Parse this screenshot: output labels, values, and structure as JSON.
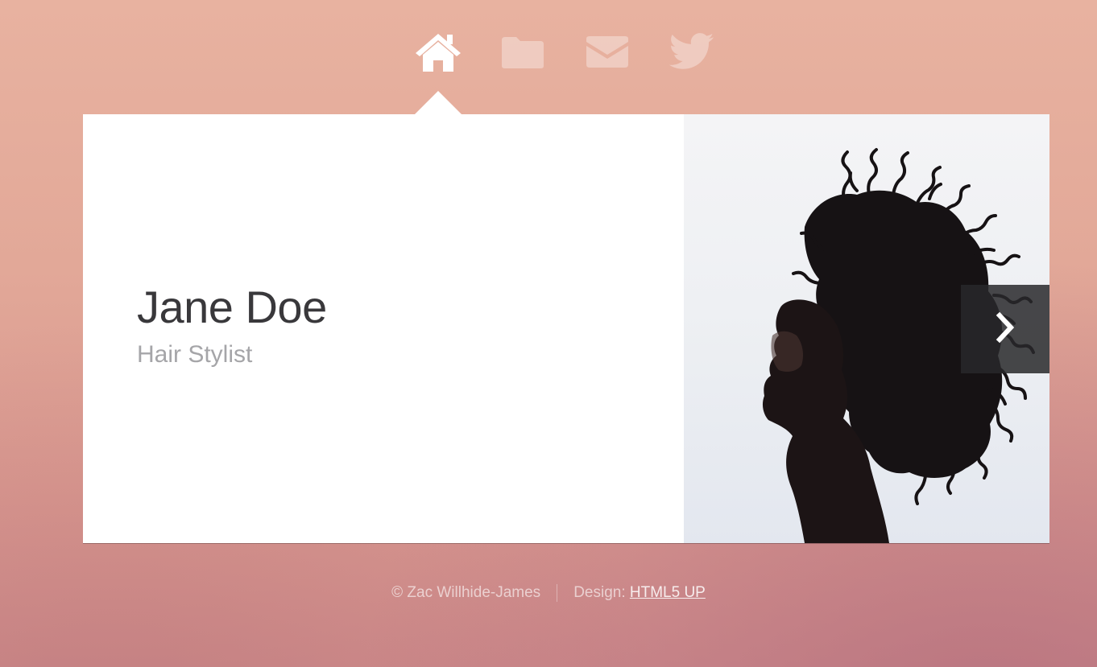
{
  "nav": {
    "items": [
      {
        "icon": "home-icon",
        "active": true
      },
      {
        "icon": "folder-icon",
        "active": false
      },
      {
        "icon": "envelope-icon",
        "active": false
      },
      {
        "icon": "twitter-icon",
        "active": false
      }
    ]
  },
  "profile": {
    "name": "Jane Doe",
    "role": "Hair Stylist"
  },
  "photo": {
    "next_icon": "chevron-right-icon"
  },
  "footer": {
    "copyright": "© Zac Willhide-James",
    "design_prefix": "Design: ",
    "design_link": "HTML5 UP"
  },
  "colors": {
    "background": "#e2a898",
    "panel": "#ffffff",
    "name_text": "#39383b",
    "role_text": "#a5a5a8",
    "arrow_bg": "#2a2a2c"
  }
}
